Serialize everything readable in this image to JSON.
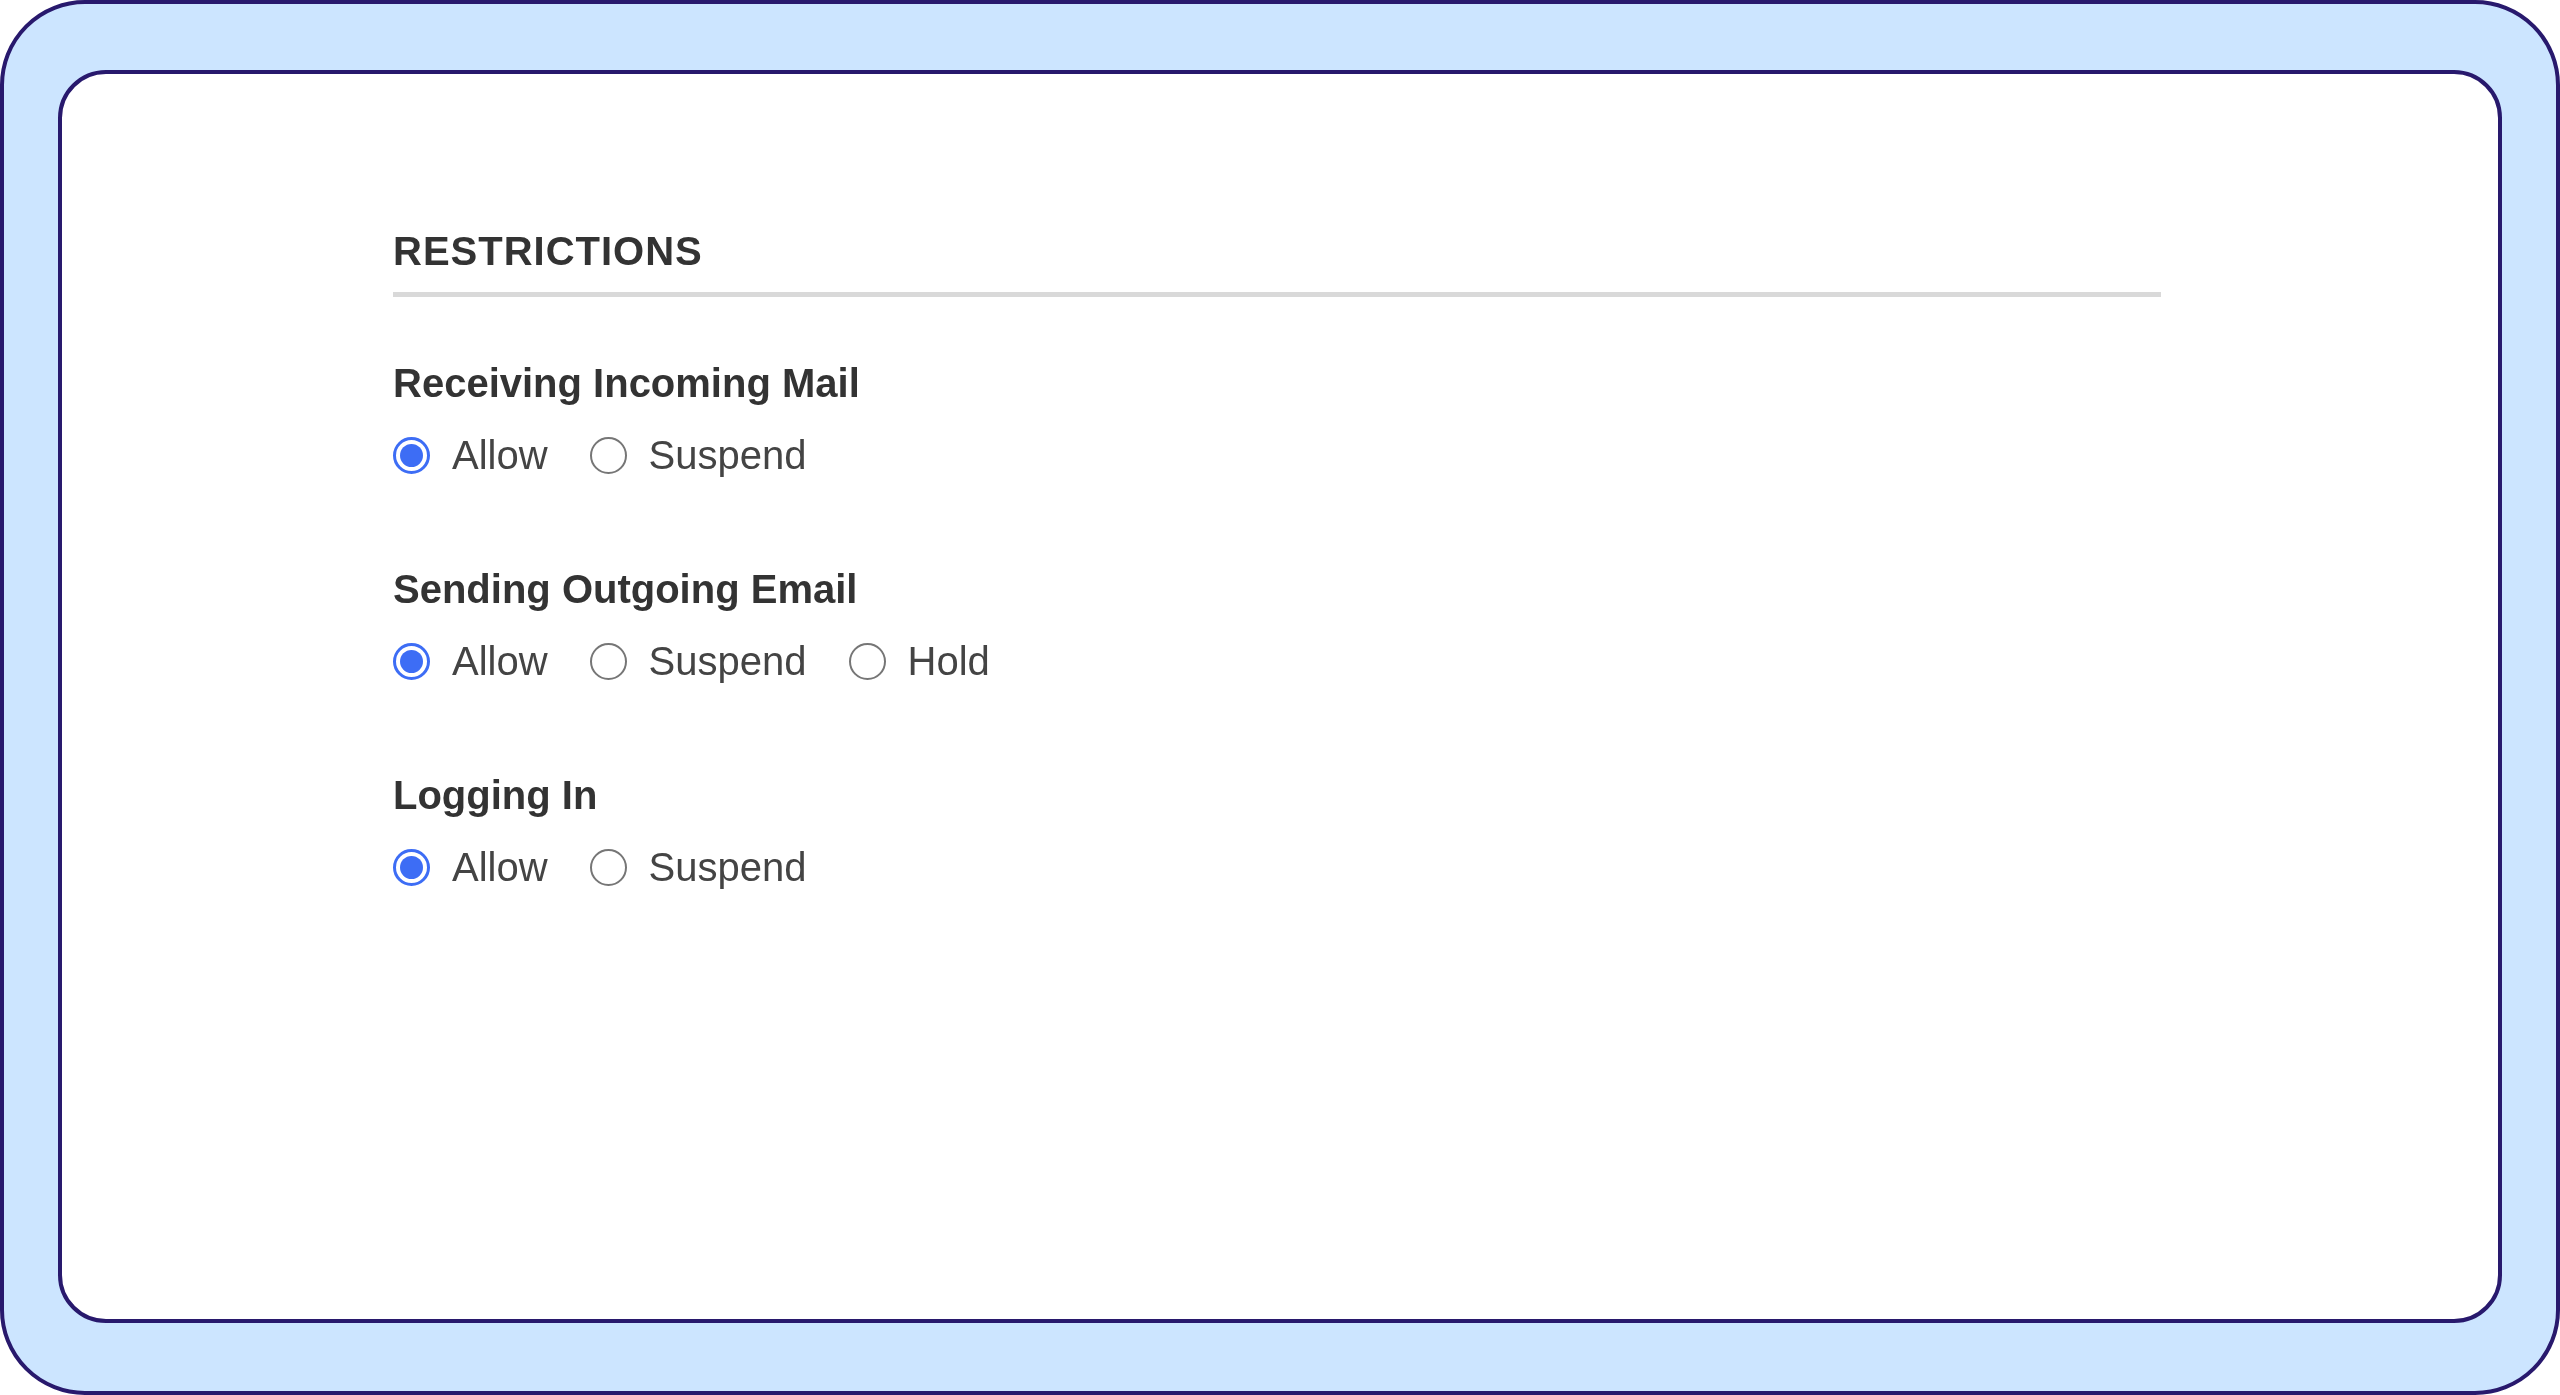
{
  "section": {
    "title": "RESTRICTIONS"
  },
  "groups": [
    {
      "label": "Receiving Incoming Mail",
      "options": [
        {
          "label": "Allow",
          "selected": true
        },
        {
          "label": "Suspend",
          "selected": false
        }
      ]
    },
    {
      "label": "Sending Outgoing Email",
      "options": [
        {
          "label": "Allow",
          "selected": true
        },
        {
          "label": "Suspend",
          "selected": false
        },
        {
          "label": "Hold",
          "selected": false
        }
      ]
    },
    {
      "label": "Logging In",
      "options": [
        {
          "label": "Allow",
          "selected": true
        },
        {
          "label": "Suspend",
          "selected": false
        }
      ]
    }
  ]
}
